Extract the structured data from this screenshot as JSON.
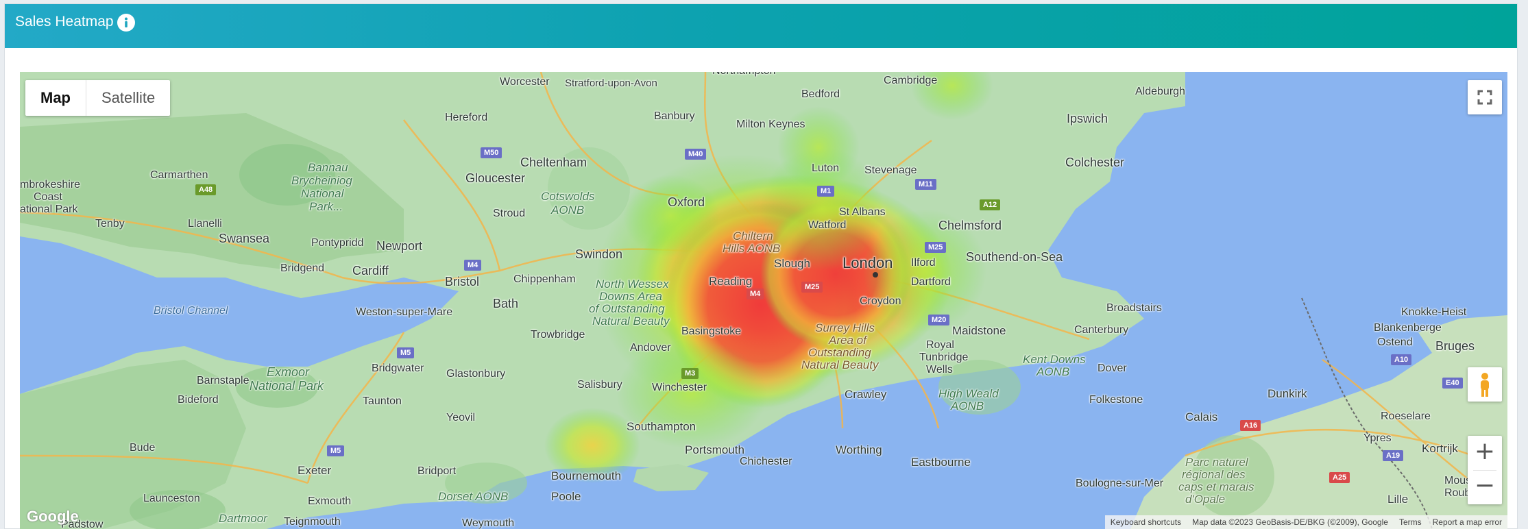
{
  "header": {
    "title": "Sales Heatmap",
    "info_icon": "info-icon"
  },
  "map": {
    "type_controls": {
      "map_label": "Map",
      "satellite_label": "Satellite",
      "selected": "Map"
    },
    "controls": {
      "fullscreen_icon": "fullscreen-icon",
      "pegman_icon": "street-view-pegman-icon",
      "zoom_in_label": "+",
      "zoom_out_label": "−"
    },
    "places": {
      "northampton": "Northampton",
      "cambridge": "Cambridge",
      "worcester": "Worcester",
      "stratford": "Stratford-upon-Avon",
      "bedford": "Bedford",
      "aldeburgh": "Aldeburgh",
      "hereford": "Hereford",
      "banbury": "Banbury",
      "milton_keynes": "Milton Keynes",
      "ipswich": "Ipswich",
      "bannau": "Bannau",
      "brycheiniog": "Brycheiniog",
      "national": "National",
      "park": "Park...",
      "cheltenham": "Cheltenham",
      "colchester": "Colchester",
      "carmarthen": "Carmarthen",
      "gloucester": "Gloucester",
      "luton": "Luton",
      "stevenage": "Stevenage",
      "pembrokeshire": "mbrokeshire",
      "coast": "Coast",
      "national_park": "ational Park",
      "cotswolds": "Cotswolds",
      "aonb": "AONB",
      "oxford": "Oxford",
      "stroud": "Stroud",
      "st_albans": "St Albans",
      "tenby": "Tenby",
      "llanelli": "Llanelli",
      "swansea": "Swansea",
      "watford": "Watford",
      "chelmsford": "Chelmsford",
      "chiltern": "Chiltern",
      "hills_aonb": "Hills AONB",
      "pontypridd": "Pontypridd",
      "newport": "Newport",
      "swindon": "Swindon",
      "london": "London",
      "ilford": "Ilford",
      "southend": "Southend-on-Sea",
      "slough": "Slough",
      "bridgend": "Bridgend",
      "cardiff": "Cardiff",
      "bristol": "Bristol",
      "chippenham": "Chippenham",
      "north_wessex": "North Wessex",
      "downs_area": "Downs Area",
      "of_outstanding": "of Outstanding",
      "natural_beauty": "Natural Beauty",
      "reading": "Reading",
      "dartford": "Dartford",
      "bath": "Bath",
      "croydon": "Croydon",
      "bristol_channel": "Bristol Channel",
      "weston": "Weston-super-Mare",
      "broadstairs": "Broadstairs",
      "knokke": "Knokke-Heist",
      "trowbridge": "Trowbridge",
      "basingstoke": "Basingstoke",
      "surrey_hills": "Surrey Hills",
      "area_of": "Area of",
      "outstanding": "Outstanding",
      "natural_beauty2": "Natural Beauty",
      "maidstone": "Maidstone",
      "canterbury": "Canterbury",
      "blankenberge": "Blankenberge",
      "ostend": "Ostend",
      "bruges": "Bruges",
      "andover": "Andover",
      "royal": "Royal",
      "tunbridge": "Tunbridge",
      "wells": "Wells",
      "kent_downs": "Kent Downs",
      "kent_aonb": "AONB",
      "dover": "Dover",
      "exmoor": "Exmoor",
      "exmoor_np": "National Park",
      "barnstaple": "Barnstaple",
      "bridgwater": "Bridgwater",
      "glastonbury": "Glastonbury",
      "salisbury": "Salisbury",
      "winchester": "Winchester",
      "crawley": "Crawley",
      "bideford": "Bideford",
      "taunton": "Taunton",
      "high_weald": "High Weald",
      "high_weald_aonb": "AONB",
      "folkestone": "Folkestone",
      "dunkirk": "Dunkirk",
      "calais": "Calais",
      "roeselare": "Roeselare",
      "yeovil": "Yeovil",
      "southampton": "Southampton",
      "ypres": "Ypres",
      "kortrijk": "Kortrijk",
      "bude": "Bude",
      "portsmouth": "Portsmouth",
      "chichester": "Chichester",
      "worthing": "Worthing",
      "eastbourne": "Eastbourne",
      "exeter": "Exeter",
      "bridport": "Bridport",
      "bournemouth": "Bournemouth",
      "parc": "Parc naturel",
      "regional": "régional des",
      "caps": "caps et marais",
      "opale": "d'Opale",
      "mouscron": "Mousc",
      "roubaix": "Roubai",
      "launceston": "Launceston",
      "exmouth": "Exmouth",
      "dorset_aonb": "Dorset AONB",
      "poole": "Poole",
      "boulogne": "Boulogne-sur-Mer",
      "lille": "Lille",
      "dartmoor": "Dartmoor",
      "teignmouth": "Teignmouth",
      "weymouth": "Weymouth",
      "padstow": "Padstow"
    },
    "roads": {
      "m50": "M50",
      "m40": "M40",
      "m1": "M1",
      "m11": "M11",
      "a48": "A48",
      "a12": "A12",
      "m4": "M4",
      "m25": "M25",
      "m25_inner": "M25",
      "m4_inner": "M4",
      "m20": "M20",
      "m5": "M5",
      "m5b": "M5",
      "m3": "M3",
      "a10": "A10",
      "e40": "E40",
      "a16": "A16",
      "a19": "A19",
      "a25": "A25"
    },
    "attribution": {
      "keyboard": "Keyboard shortcuts",
      "map_data": "Map data ©2023 GeoBasis-DE/BKG (©2009), Google",
      "terms": "Terms",
      "report": "Report a map error"
    },
    "google_logo": "Google",
    "heatmap_points": [
      {
        "place": "London",
        "intensity": 1.0
      },
      {
        "place": "Slough",
        "intensity": 1.0
      },
      {
        "place": "Reading",
        "intensity": 0.95
      },
      {
        "place": "Croydon",
        "intensity": 0.85
      },
      {
        "place": "Basingstoke",
        "intensity": 0.9
      },
      {
        "place": "Surrey Hills",
        "intensity": 0.8
      },
      {
        "place": "Watford",
        "intensity": 0.5
      },
      {
        "place": "Luton",
        "intensity": 0.35
      },
      {
        "place": "Bournemouth",
        "intensity": 0.45
      },
      {
        "place": "Oxford",
        "intensity": 0.3
      },
      {
        "place": "Winchester",
        "intensity": 0.35
      }
    ]
  }
}
